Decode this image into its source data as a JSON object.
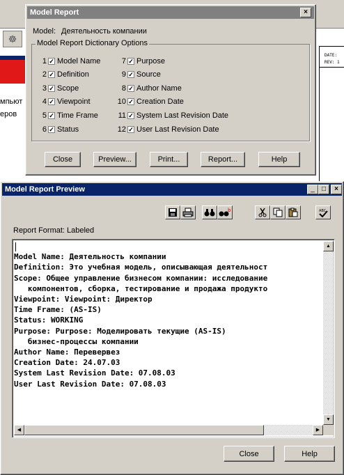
{
  "background_window": {
    "left_texts": [
      "мпьют",
      "еров"
    ],
    "right_texts": [
      "DATE:",
      "REV: 1"
    ]
  },
  "model_report_dialog": {
    "title": "Model Report",
    "close_glyph": "×",
    "model_label": "Model:",
    "model_name": "Деятельность компании",
    "group_label": "Model Report Dictionary Options",
    "options_left": [
      {
        "num": "1",
        "label": "Model Name",
        "checked": true
      },
      {
        "num": "2",
        "label": "Definition",
        "checked": true
      },
      {
        "num": "3",
        "label": "Scope",
        "checked": true
      },
      {
        "num": "4",
        "label": "Viewpoint",
        "checked": true
      },
      {
        "num": "5",
        "label": "Time Frame",
        "checked": true
      },
      {
        "num": "6",
        "label": "Status",
        "checked": true
      }
    ],
    "options_right": [
      {
        "num": "7",
        "label": "Purpose",
        "checked": true
      },
      {
        "num": "9",
        "label": "Source",
        "checked": true
      },
      {
        "num": "8",
        "label": "Author Name",
        "checked": true
      },
      {
        "num": "10",
        "label": "Creation Date",
        "checked": true
      },
      {
        "num": "11",
        "label": "System Last Revision Date",
        "checked": true
      },
      {
        "num": "12",
        "label": "User Last Revision Date",
        "checked": true
      }
    ],
    "buttons": {
      "close": "Close",
      "preview": "Preview...",
      "print": "Print...",
      "report": "Report...",
      "help": "Help"
    }
  },
  "preview_window": {
    "title": "Model Report Preview",
    "title_buttons": [
      "_",
      "□",
      "×"
    ],
    "toolbar_icons": [
      "save-icon",
      "print-icon",
      "find-icon",
      "find-next-icon",
      "cut-icon",
      "copy-icon",
      "paste-icon",
      "spell-check-icon"
    ],
    "report_format": "Report Format: Labeled",
    "report_lines": [
      "",
      "Model Name: Деятельность компании",
      "Definition: Это учебная модель, описывающая деятельност",
      "Scope: Общее управление бизнесом компании: исследование",
      "   компонентов, сборка, тестирование и продажа продукто",
      "Viewpoint: Viewpoint: Директор",
      "Time Frame: (AS-IS)",
      "Status: WORKING",
      "Purpose: Purpose: Моделировать текущие (AS-IS)",
      "   бизнес-процессы компании",
      "Author Name: Перевервез",
      "Creation Date: 24.07.03",
      "System Last Revision Date: 07.08.03",
      "User Last Revision Date: 07.08.03"
    ],
    "buttons": {
      "close": "Close",
      "help": "Help"
    }
  },
  "colors": {
    "title_active": "#0a246a",
    "title_inactive": "#808080",
    "face": "#d4d0c8"
  }
}
